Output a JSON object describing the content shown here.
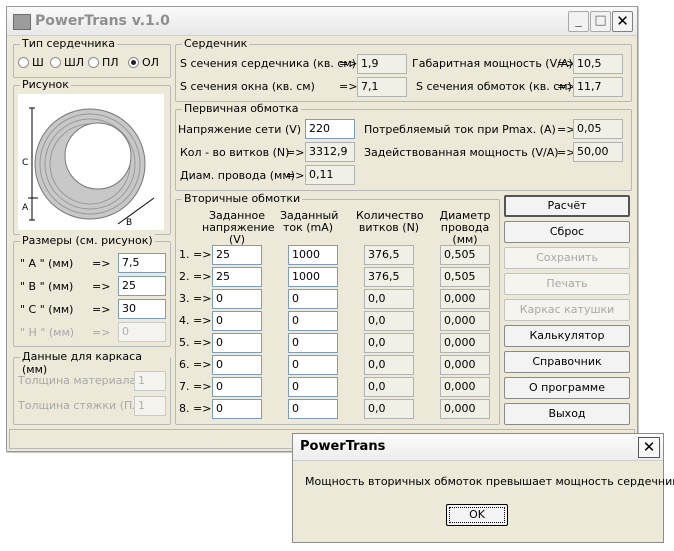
{
  "window": {
    "title": "PowerTrans v.1.0",
    "minimize_glyph": "_",
    "maximize_glyph": "□",
    "close_glyph": "✕"
  },
  "core_type": {
    "title": "Тип сердечника",
    "options": [
      {
        "label": "Ш",
        "selected": false
      },
      {
        "label": "ШЛ",
        "selected": false
      },
      {
        "label": "ПЛ",
        "selected": false
      },
      {
        "label": "ОЛ",
        "selected": true
      }
    ]
  },
  "drawing": {
    "title": "Рисунок",
    "label_c": "С",
    "label_a": "А",
    "label_b": "В"
  },
  "dimensions": {
    "title": "Размеры (см. рисунок)",
    "rows": [
      {
        "label": "\" А \"  (мм)",
        "arrow": "=>",
        "value": "7,5"
      },
      {
        "label": "\" В \"  (мм)",
        "arrow": "=>",
        "value": "25"
      },
      {
        "label": "\" С \"  (мм)",
        "arrow": "=>",
        "value": "30"
      },
      {
        "label": "\" Н \"  (мм)",
        "arrow": "=>",
        "value": "0"
      }
    ]
  },
  "frame_data": {
    "title": "Данные для каркаса (мм)",
    "material_label": "Толщина материала",
    "material_value": "1",
    "tie_label": "Толщина стяжки (ПЛ)",
    "tie_value": "1"
  },
  "core": {
    "title": "Сердечник",
    "core_section_label": "S сечения сердечника (кв. см)",
    "core_section_arrow": "=>",
    "core_section_value": "1,9",
    "window_section_label": "S сечения окна (кв. см)",
    "window_section_arrow": "=>",
    "window_section_value": "7,1",
    "overall_power_label": "Габаритная мощность (V/A)",
    "overall_power_arrow": "=>",
    "overall_power_value": "10,5",
    "windings_section_label": "S сечения обмоток (кв. см)",
    "windings_section_arrow": "=>",
    "windings_section_value": "11,7"
  },
  "primary": {
    "title": "Первичная обмотка",
    "voltage_label": "Напряжение сети (V) =>",
    "voltage_value": "220",
    "turns_label": "Кол - во витков (N)",
    "turns_arrow": "=>",
    "turns_value": "3312,9",
    "wire_label": "Диам. провода (мм)",
    "wire_arrow": "=>",
    "wire_value": "0,11",
    "current_label": "Потребляемый ток при Pmax. (А)",
    "current_arrow": "=>",
    "current_value": "0,05",
    "used_power_label": "Задействованная мощность (V/A)",
    "used_power_arrow": "=>",
    "used_power_value": "50,00"
  },
  "secondary": {
    "title": "Вторичные обмотки",
    "headers": [
      "Заданное\nнапряжение (V)",
      "Заданный\nток (mA)",
      "Количество\nвитков (N)",
      "Диаметр\nпровода (мм)"
    ],
    "rows": [
      {
        "num": "1. =>",
        "voltage": "25",
        "current": "1000",
        "turns": "376,5",
        "diameter": "0,505"
      },
      {
        "num": "2. =>",
        "voltage": "25",
        "current": "1000",
        "turns": "376,5",
        "diameter": "0,505"
      },
      {
        "num": "3. =>",
        "voltage": "0",
        "current": "0",
        "turns": "0,0",
        "diameter": "0,000"
      },
      {
        "num": "4. =>",
        "voltage": "0",
        "current": "0",
        "turns": "0,0",
        "diameter": "0,000"
      },
      {
        "num": "5. =>",
        "voltage": "0",
        "current": "0",
        "turns": "0,0",
        "diameter": "0,000"
      },
      {
        "num": "6. =>",
        "voltage": "0",
        "current": "0",
        "turns": "0,0",
        "diameter": "0,000"
      },
      {
        "num": "7. =>",
        "voltage": "0",
        "current": "0",
        "turns": "0,0",
        "diameter": "0,000"
      },
      {
        "num": "8. =>",
        "voltage": "0",
        "current": "0",
        "turns": "0,0",
        "diameter": "0,000"
      }
    ]
  },
  "buttons": {
    "calculate": "Расчёт",
    "reset": "Сброс",
    "save": "Сохранить",
    "print": "Печать",
    "bobbin": "Каркас катушки",
    "calculator": "Калькулятор",
    "reference": "Справочник",
    "about": "О программе",
    "exit": "Выход"
  },
  "dialog": {
    "title": "PowerTrans",
    "close_glyph": "✕",
    "message": "Мощность вторичных обмоток превышает мощность сердечника!",
    "ok_label": "OK"
  }
}
